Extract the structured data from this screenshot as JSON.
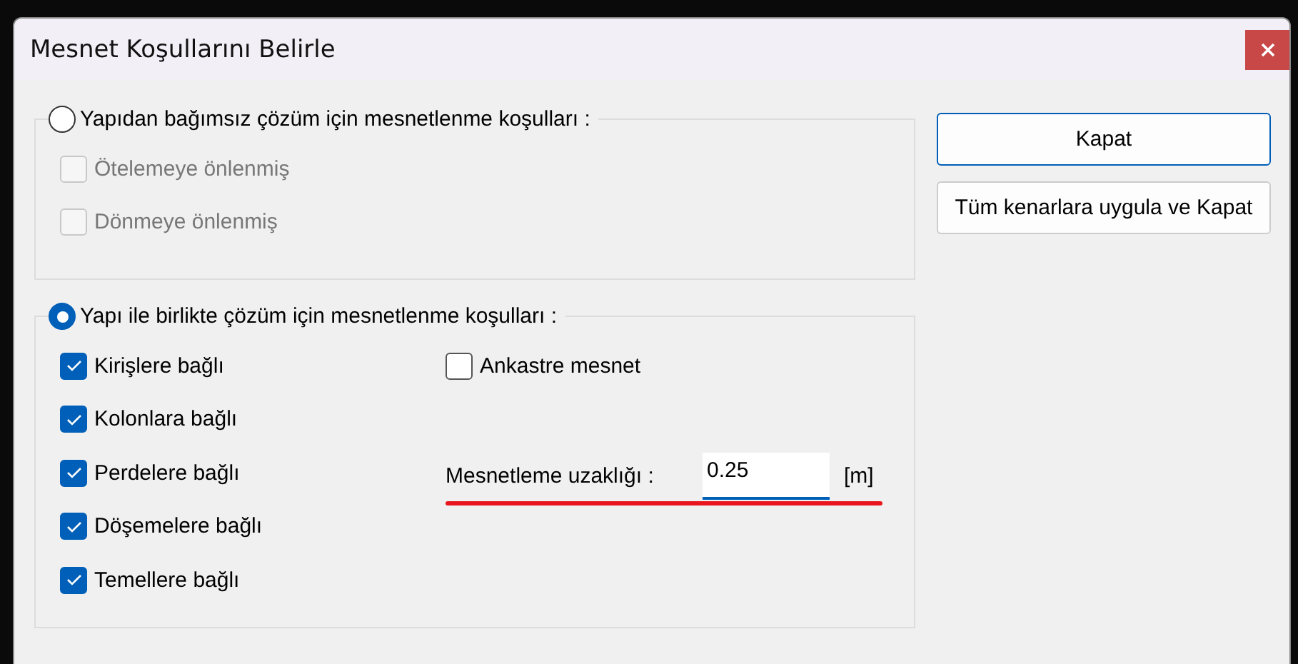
{
  "window": {
    "title": "Mesnet Koşullarını Belirle"
  },
  "groups": [
    {
      "label": "Yapıdan bağımsız çözüm için mesnetlenme koşulları  :",
      "selected": false,
      "left_checks": [
        {
          "label": "Ötelemeye önlenmiş",
          "checked": false,
          "disabled": true
        },
        {
          "label": "Dönmeye önlenmiş",
          "checked": false,
          "disabled": true
        }
      ]
    },
    {
      "label": "Yapı ile birlikte çözüm için mesnetlenme koşulları  :",
      "selected": true,
      "left_checks": [
        {
          "label": "Kirişlere bağlı",
          "checked": true,
          "disabled": false
        },
        {
          "label": "Kolonlara bağlı",
          "checked": true,
          "disabled": false
        },
        {
          "label": "Perdelere bağlı",
          "checked": true,
          "disabled": false
        },
        {
          "label": "Döşemelere bağlı",
          "checked": true,
          "disabled": false
        },
        {
          "label": "Temellere bağlı",
          "checked": true,
          "disabled": false
        }
      ],
      "right_checks": [
        {
          "label": "Ankastre mesnet",
          "checked": false,
          "disabled": false
        }
      ],
      "field": {
        "label": "Mesnetleme uzaklığı :",
        "value": "0.25",
        "unit": "[m]",
        "underlined": true
      }
    }
  ],
  "buttons": [
    {
      "label": "Kapat",
      "default": true
    },
    {
      "label": "Tüm kenarlara uygula ve Kapat",
      "default": false
    }
  ]
}
